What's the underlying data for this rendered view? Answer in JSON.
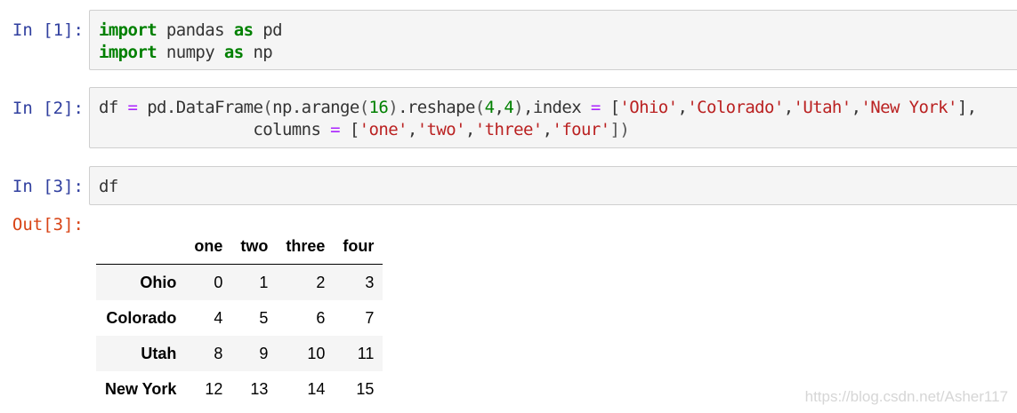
{
  "cells": [
    {
      "prompt": "In [1]:",
      "lines": [
        [
          {
            "t": "import",
            "c": "kw"
          },
          {
            "t": " pandas ",
            "c": ""
          },
          {
            "t": "as",
            "c": "kw"
          },
          {
            "t": " pd",
            "c": ""
          }
        ],
        [
          {
            "t": "import",
            "c": "kw"
          },
          {
            "t": " numpy ",
            "c": ""
          },
          {
            "t": "as",
            "c": "kw"
          },
          {
            "t": " np",
            "c": ""
          }
        ]
      ]
    },
    {
      "prompt": "In [2]:",
      "lines": [
        [
          {
            "t": "df ",
            "c": ""
          },
          {
            "t": "=",
            "c": "op"
          },
          {
            "t": " pd.DataFrame",
            "c": ""
          },
          {
            "t": "(",
            "c": "br"
          },
          {
            "t": "np.arange",
            "c": ""
          },
          {
            "t": "(",
            "c": "br"
          },
          {
            "t": "16",
            "c": "num"
          },
          {
            "t": ")",
            "c": "br"
          },
          {
            "t": ".reshape",
            "c": ""
          },
          {
            "t": "(",
            "c": "br"
          },
          {
            "t": "4",
            "c": "num"
          },
          {
            "t": ",",
            "c": ""
          },
          {
            "t": "4",
            "c": "num"
          },
          {
            "t": ")",
            "c": "br"
          },
          {
            "t": ",index ",
            "c": ""
          },
          {
            "t": "=",
            "c": "op"
          },
          {
            "t": " [",
            "c": ""
          },
          {
            "t": "'Ohio'",
            "c": "str"
          },
          {
            "t": ",",
            "c": ""
          },
          {
            "t": "'Colorado'",
            "c": "str"
          },
          {
            "t": ",",
            "c": ""
          },
          {
            "t": "'Utah'",
            "c": "str"
          },
          {
            "t": ",",
            "c": ""
          },
          {
            "t": "'New York'",
            "c": "str"
          },
          {
            "t": "],",
            "c": ""
          }
        ],
        [
          {
            "t": "                columns ",
            "c": ""
          },
          {
            "t": "=",
            "c": "op"
          },
          {
            "t": " [",
            "c": ""
          },
          {
            "t": "'one'",
            "c": "str"
          },
          {
            "t": ",",
            "c": ""
          },
          {
            "t": "'two'",
            "c": "str"
          },
          {
            "t": ",",
            "c": ""
          },
          {
            "t": "'three'",
            "c": "str"
          },
          {
            "t": ",",
            "c": ""
          },
          {
            "t": "'four'",
            "c": "str"
          },
          {
            "t": "])",
            "c": "br"
          }
        ]
      ]
    },
    {
      "prompt": "In [3]:",
      "lines": [
        [
          {
            "t": "df",
            "c": ""
          }
        ]
      ]
    }
  ],
  "output": {
    "prompt": "Out[3]:",
    "columns": [
      "one",
      "two",
      "three",
      "four"
    ],
    "rows": [
      {
        "index": "Ohio",
        "values": [
          "0",
          "1",
          "2",
          "3"
        ]
      },
      {
        "index": "Colorado",
        "values": [
          "4",
          "5",
          "6",
          "7"
        ]
      },
      {
        "index": "Utah",
        "values": [
          "8",
          "9",
          "10",
          "11"
        ]
      },
      {
        "index": "New York",
        "values": [
          "12",
          "13",
          "14",
          "15"
        ]
      }
    ]
  },
  "watermark": "https://blog.csdn.net/Asher117"
}
